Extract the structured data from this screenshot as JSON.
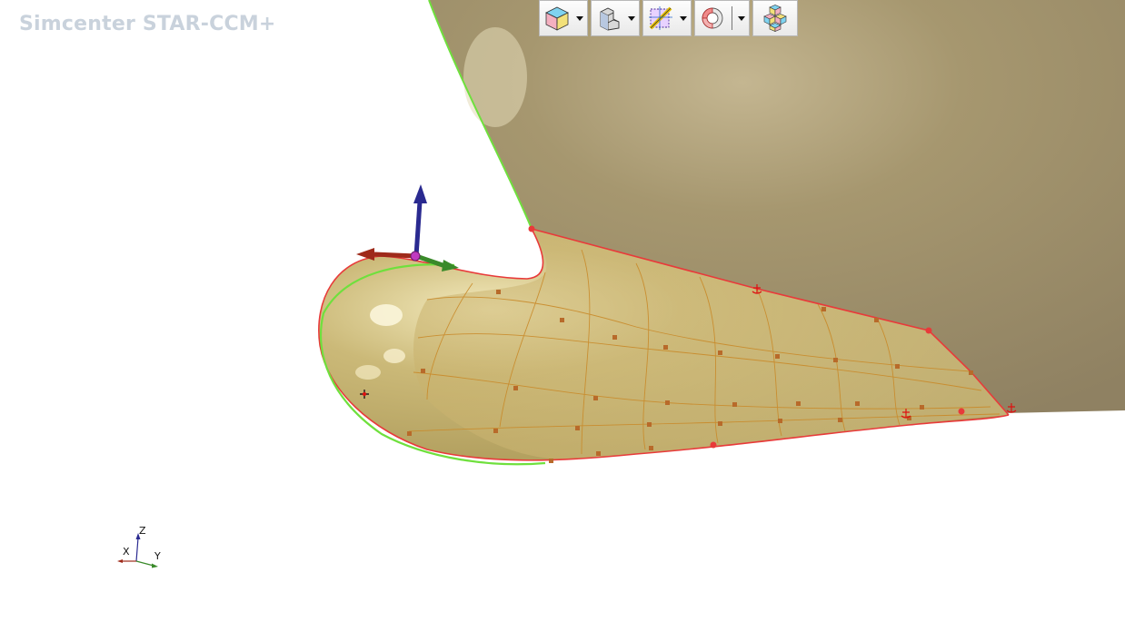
{
  "app": {
    "watermark": "Simcenter STAR-CCM+"
  },
  "toolbar": {
    "buttons": [
      {
        "name": "view-cube-button",
        "icon": "iso-cube-icon",
        "has_menu": true
      },
      {
        "name": "part-display-button",
        "icon": "l-block-icon",
        "has_menu": true
      },
      {
        "name": "plane-section-button",
        "icon": "section-plane-icon",
        "has_menu": true
      },
      {
        "name": "cylindrical-section-button",
        "icon": "cylinder-section-icon",
        "has_menu": true
      },
      {
        "name": "explode-parts-button",
        "icon": "exploded-cubes-icon",
        "has_menu": false
      }
    ]
  },
  "triad": {
    "z_label": "Z",
    "x_label": "X",
    "y_label": "Y"
  },
  "colors": {
    "hull": "#9c8e6e",
    "bulb_surface": "#c9b577",
    "highlight_edge": "#6fe03d",
    "curve_edge": "#e83a3a",
    "control_point": "#b86a2a"
  }
}
